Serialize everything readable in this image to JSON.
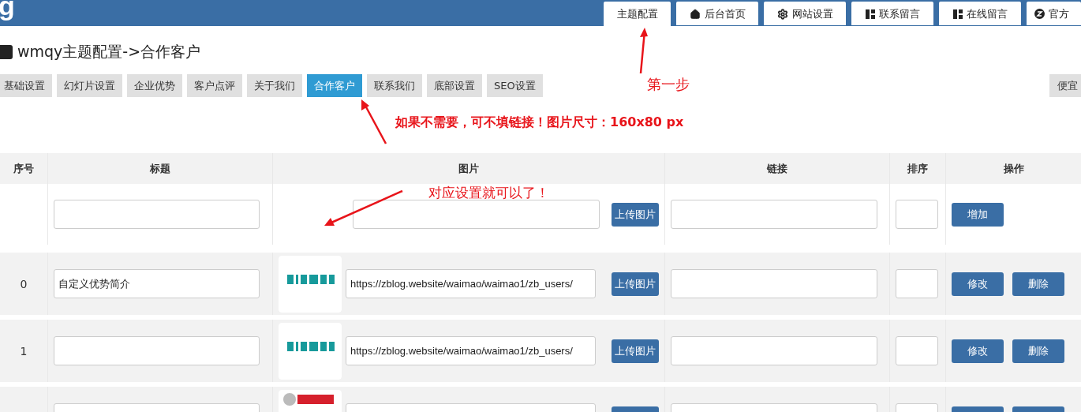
{
  "header": {
    "logo": "g",
    "nav": [
      {
        "label": "主题配置",
        "selected": true
      },
      {
        "label": "后台首页",
        "selected": false
      },
      {
        "label": "网站设置",
        "selected": false
      },
      {
        "label": "联系留言",
        "selected": false
      },
      {
        "label": "在线留言",
        "selected": false
      },
      {
        "label": "官方",
        "selected": false
      }
    ]
  },
  "page_title": "wmqy主题配置->合作客户",
  "subtabs": [
    {
      "label": "基础设置",
      "selected": false
    },
    {
      "label": "幻灯片设置",
      "selected": false
    },
    {
      "label": "企业优势",
      "selected": false
    },
    {
      "label": "客户点评",
      "selected": false
    },
    {
      "label": "关于我们",
      "selected": false
    },
    {
      "label": "合作客户",
      "selected": true
    },
    {
      "label": "联系我们",
      "selected": false
    },
    {
      "label": "底部设置",
      "selected": false
    },
    {
      "label": "SEO设置",
      "selected": false
    }
  ],
  "side_button": "便宜",
  "table": {
    "columns": [
      "序号",
      "标题",
      "图片",
      "链接",
      "排序",
      "操作"
    ],
    "new_row": {
      "upload": "上传图片",
      "action": "增加"
    },
    "rows": [
      {
        "index": "0",
        "title": "自定义优势简介",
        "image": {
          "kind": "picture"
        },
        "url": "https://zblog.website/waimao/waimao1/zb_users/",
        "upload": "上传图片",
        "buttons": [
          "修改",
          "删除"
        ]
      },
      {
        "index": "1",
        "title": "",
        "image": {
          "kind": "picture"
        },
        "url": "https://zblog.website/waimao/waimao1/zb_users/",
        "upload": "上传图片",
        "buttons": [
          "修改",
          "删除"
        ]
      },
      {
        "image": {
          "kind": "picture"
        }
      }
    ]
  },
  "annotations": [
    {
      "text": "第一步"
    },
    {
      "text": "如果不需要，可不填链接！图片尺寸：160x80 px"
    },
    {
      "text": "对应设置就可以了！"
    }
  ]
}
